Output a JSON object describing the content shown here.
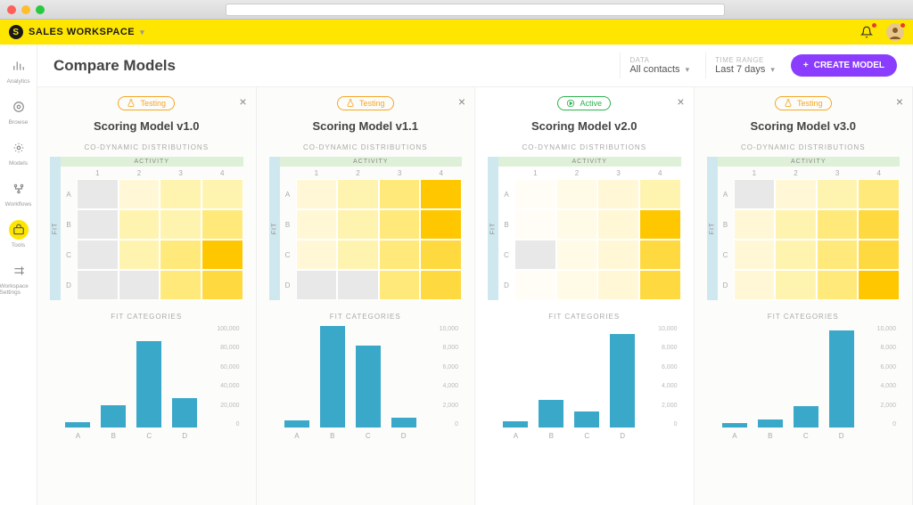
{
  "workspace": {
    "name": "SALES WORKSPACE"
  },
  "sidebar": {
    "items": [
      {
        "label": "Analytics"
      },
      {
        "label": "Browse"
      },
      {
        "label": "Models"
      },
      {
        "label": "Workflows"
      },
      {
        "label": "Tools"
      },
      {
        "label": "Workspace Settings"
      }
    ],
    "active_index": 4
  },
  "header": {
    "title": "Compare Models",
    "filters": {
      "data": {
        "label": "DATA",
        "value": "All contacts"
      },
      "time": {
        "label": "TIME RANGE",
        "value": "Last 7 days"
      }
    },
    "create_label": "CREATE MODEL"
  },
  "panels": [
    {
      "status": "Testing",
      "status_kind": "testing",
      "name": "Scoring Model v1.0",
      "co_dynamic_label": "CO-DYNAMIC DISTRIBUTIONS",
      "activity_label": "ACTIVITY",
      "fit_label": "FIT",
      "heatmap": {
        "cols": [
          "1",
          "2",
          "3",
          "4"
        ],
        "rows": [
          "A",
          "B",
          "C",
          "D"
        ],
        "colors": [
          [
            "#e8e8e8",
            "#fff7d6",
            "#fff3b0",
            "#fff3b0"
          ],
          [
            "#e8e8e8",
            "#fff3b0",
            "#fff3b0",
            "#ffe97a"
          ],
          [
            "#e8e8e8",
            "#fff3b0",
            "#ffe97a",
            "#ffc700"
          ],
          [
            "#e8e8e8",
            "#e8e8e8",
            "#ffe97a",
            "#ffd940"
          ]
        ]
      },
      "fit_categories_label": "FIT CATEGORIES",
      "bars": {
        "categories": [
          "A",
          "B",
          "C",
          "D"
        ],
        "values": [
          5000,
          22000,
          85000,
          29000
        ],
        "ymax": 100000,
        "yticks": [
          "100,000",
          "80,000",
          "60,000",
          "40,000",
          "20,000",
          "0"
        ]
      }
    },
    {
      "status": "Testing",
      "status_kind": "testing",
      "name": "Scoring Model v1.1",
      "co_dynamic_label": "CO-DYNAMIC DISTRIBUTIONS",
      "activity_label": "ACTIVITY",
      "fit_label": "FIT",
      "heatmap": {
        "cols": [
          "1",
          "2",
          "3",
          "4"
        ],
        "rows": [
          "A",
          "B",
          "C",
          "D"
        ],
        "colors": [
          [
            "#fff7d6",
            "#fff3b0",
            "#ffe97a",
            "#ffc700"
          ],
          [
            "#fff7d6",
            "#fff3b0",
            "#ffe97a",
            "#ffc700"
          ],
          [
            "#fff7d6",
            "#fff3b0",
            "#ffe97a",
            "#ffd940"
          ],
          [
            "#e8e8e8",
            "#e8e8e8",
            "#ffe97a",
            "#ffd940"
          ]
        ]
      },
      "fit_categories_label": "FIT CATEGORIES",
      "bars": {
        "categories": [
          "A",
          "B",
          "C",
          "D"
        ],
        "values": [
          700,
          10000,
          8100,
          1000
        ],
        "ymax": 10000,
        "yticks": [
          "10,000",
          "8,000",
          "6,000",
          "4,000",
          "2,000",
          "0"
        ]
      }
    },
    {
      "status": "Active",
      "status_kind": "active",
      "name": "Scoring Model v2.0",
      "co_dynamic_label": "CO-DYNAMIC DISTRIBUTIONS",
      "activity_label": "ACTIVITY",
      "fit_label": "FIT",
      "heatmap": {
        "cols": [
          "1",
          "2",
          "3",
          "4"
        ],
        "rows": [
          "A",
          "B",
          "C",
          "D"
        ],
        "colors": [
          [
            "#fffdf5",
            "#fffbe6",
            "#fff7d6",
            "#fff3b0"
          ],
          [
            "#fffdf5",
            "#fffbe6",
            "#fff7d6",
            "#ffc700"
          ],
          [
            "#e8e8e8",
            "#fffbe6",
            "#fff7d6",
            "#ffd940"
          ],
          [
            "#fffdf5",
            "#fffbe6",
            "#fff7d6",
            "#ffd940"
          ]
        ]
      },
      "fit_categories_label": "FIT CATEGORIES",
      "bars": {
        "categories": [
          "A",
          "B",
          "C",
          "D"
        ],
        "values": [
          600,
          2700,
          1600,
          9200
        ],
        "ymax": 10000,
        "yticks": [
          "10,000",
          "8,000",
          "6,000",
          "4,000",
          "2,000",
          "0"
        ]
      }
    },
    {
      "status": "Testing",
      "status_kind": "testing",
      "name": "Scoring Model v3.0",
      "co_dynamic_label": "CO-DYNAMIC DISTRIBUTIONS",
      "activity_label": "ACTIVITY",
      "fit_label": "FIT",
      "heatmap": {
        "cols": [
          "1",
          "2",
          "3",
          "4"
        ],
        "rows": [
          "A",
          "B",
          "C",
          "D"
        ],
        "colors": [
          [
            "#e8e8e8",
            "#fff7d6",
            "#fff3b0",
            "#ffe97a"
          ],
          [
            "#fff7d6",
            "#fff3b0",
            "#ffe97a",
            "#ffd940"
          ],
          [
            "#fff7d6",
            "#fff3b0",
            "#ffe97a",
            "#ffd940"
          ],
          [
            "#fff7d6",
            "#fff3b0",
            "#ffe97a",
            "#ffc700"
          ]
        ]
      },
      "fit_categories_label": "FIT CATEGORIES",
      "bars": {
        "categories": [
          "A",
          "B",
          "C",
          "D"
        ],
        "values": [
          400,
          800,
          2100,
          9600
        ],
        "ymax": 10000,
        "yticks": [
          "10,000",
          "8,000",
          "6,000",
          "4,000",
          "2,000",
          "0"
        ]
      }
    }
  ],
  "chart_data": [
    {
      "type": "heatmap",
      "title": "Scoring Model v1.0 — Co-Dynamic Distributions",
      "x_categories": [
        "1",
        "2",
        "3",
        "4"
      ],
      "y_categories": [
        "A",
        "B",
        "C",
        "D"
      ],
      "xlabel": "ACTIVITY",
      "ylabel": "FIT",
      "intensity": [
        [
          1,
          2,
          3,
          3
        ],
        [
          1,
          3,
          3,
          4
        ],
        [
          1,
          3,
          4,
          6
        ],
        [
          1,
          1,
          4,
          5
        ]
      ]
    },
    {
      "type": "bar",
      "title": "Scoring Model v1.0 — Fit Categories",
      "categories": [
        "A",
        "B",
        "C",
        "D"
      ],
      "values": [
        5000,
        22000,
        85000,
        29000
      ],
      "ylabel": "",
      "ylim": [
        0,
        100000
      ]
    },
    {
      "type": "heatmap",
      "title": "Scoring Model v1.1 — Co-Dynamic Distributions",
      "x_categories": [
        "1",
        "2",
        "3",
        "4"
      ],
      "y_categories": [
        "A",
        "B",
        "C",
        "D"
      ],
      "xlabel": "ACTIVITY",
      "ylabel": "FIT",
      "intensity": [
        [
          2,
          3,
          4,
          6
        ],
        [
          2,
          3,
          4,
          6
        ],
        [
          2,
          3,
          4,
          5
        ],
        [
          1,
          1,
          4,
          5
        ]
      ]
    },
    {
      "type": "bar",
      "title": "Scoring Model v1.1 — Fit Categories",
      "categories": [
        "A",
        "B",
        "C",
        "D"
      ],
      "values": [
        700,
        10000,
        8100,
        1000
      ],
      "ylabel": "",
      "ylim": [
        0,
        10000
      ]
    },
    {
      "type": "heatmap",
      "title": "Scoring Model v2.0 — Co-Dynamic Distributions",
      "x_categories": [
        "1",
        "2",
        "3",
        "4"
      ],
      "y_categories": [
        "A",
        "B",
        "C",
        "D"
      ],
      "xlabel": "ACTIVITY",
      "ylabel": "FIT",
      "intensity": [
        [
          0,
          1,
          2,
          3
        ],
        [
          0,
          1,
          2,
          6
        ],
        [
          -1,
          1,
          2,
          5
        ],
        [
          0,
          1,
          2,
          5
        ]
      ]
    },
    {
      "type": "bar",
      "title": "Scoring Model v2.0 — Fit Categories",
      "categories": [
        "A",
        "B",
        "C",
        "D"
      ],
      "values": [
        600,
        2700,
        1600,
        9200
      ],
      "ylabel": "",
      "ylim": [
        0,
        10000
      ]
    },
    {
      "type": "heatmap",
      "title": "Scoring Model v3.0 — Co-Dynamic Distributions",
      "x_categories": [
        "1",
        "2",
        "3",
        "4"
      ],
      "y_categories": [
        "A",
        "B",
        "C",
        "D"
      ],
      "xlabel": "ACTIVITY",
      "ylabel": "FIT",
      "intensity": [
        [
          1,
          2,
          3,
          4
        ],
        [
          2,
          3,
          4,
          5
        ],
        [
          2,
          3,
          4,
          5
        ],
        [
          2,
          3,
          4,
          6
        ]
      ]
    },
    {
      "type": "bar",
      "title": "Scoring Model v3.0 — Fit Categories",
      "categories": [
        "A",
        "B",
        "C",
        "D"
      ],
      "values": [
        400,
        800,
        2100,
        9600
      ],
      "ylabel": "",
      "ylim": [
        0,
        10000
      ]
    }
  ]
}
